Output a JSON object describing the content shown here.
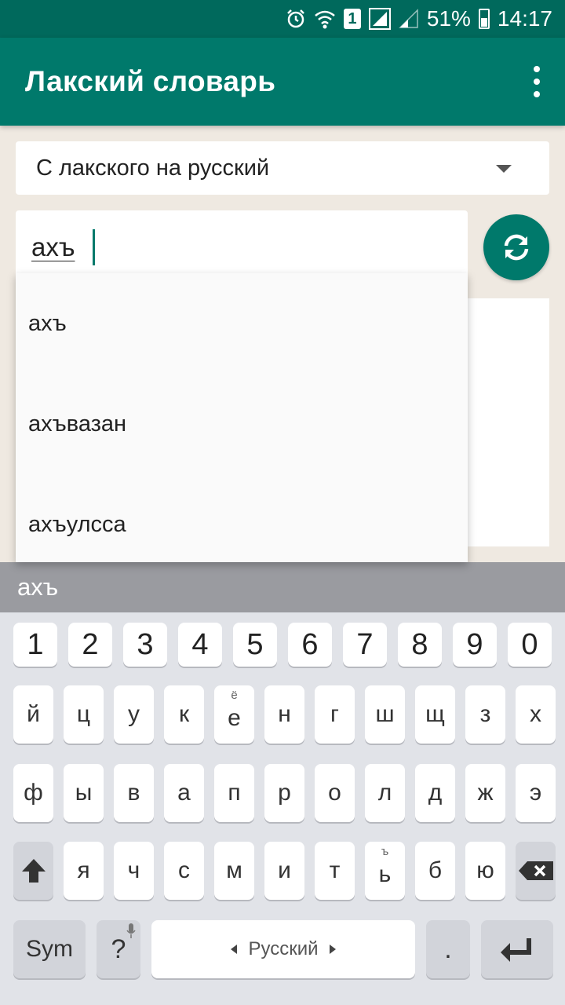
{
  "status_bar": {
    "battery": "51%",
    "time": "14:17",
    "sim_slot": "1",
    "icons": [
      "alarm-icon",
      "wifi-icon",
      "sim-icon",
      "signal-icon",
      "signal-weak-icon",
      "battery-icon"
    ]
  },
  "app_bar": {
    "title": "Лакский словарь",
    "menu_icon": "overflow-menu-icon"
  },
  "direction_select": {
    "value": "С лакского на русский"
  },
  "search": {
    "value": "ахъ"
  },
  "swap_button": {
    "icon": "refresh-icon"
  },
  "suggestions": [
    "ахъ",
    "ахъвазан",
    "ахъулсса"
  ],
  "prediction": "ахъ",
  "keyboard": {
    "numbers": [
      "1",
      "2",
      "3",
      "4",
      "5",
      "6",
      "7",
      "8",
      "9",
      "0"
    ],
    "row1": [
      "й",
      "ц",
      "у",
      "к",
      "е",
      "н",
      "г",
      "ш",
      "щ",
      "з",
      "х"
    ],
    "row1_hint_e": "ё",
    "row2": [
      "ф",
      "ы",
      "в",
      "а",
      "п",
      "р",
      "о",
      "л",
      "д",
      "ж",
      "э"
    ],
    "row3": [
      "я",
      "ч",
      "с",
      "м",
      "и",
      "т",
      "ь",
      "б",
      "ю"
    ],
    "row3_hint_soft": "ъ",
    "sym": "Sym",
    "question": "?",
    "space_label": "Русский",
    "period": ".",
    "icons": [
      "shift-icon",
      "backspace-icon",
      "microphone-icon",
      "enter-icon"
    ]
  },
  "colors": {
    "primary": "#00796b",
    "primary_dark": "#00695c",
    "background": "#efe9e1",
    "keyboard": "#e1e3e8",
    "prediction_bar": "#9a9ba0"
  }
}
